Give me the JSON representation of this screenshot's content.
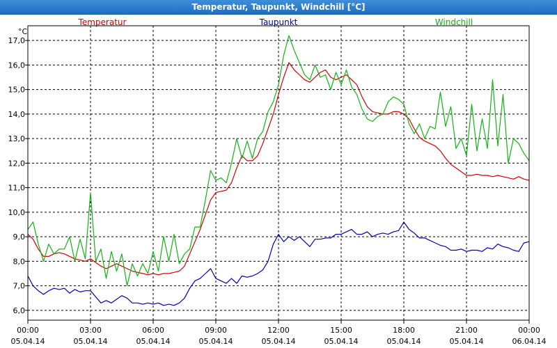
{
  "window": {
    "title": "Temperatur, Taupunkt, Windchill [°C]"
  },
  "chart_data": {
    "type": "line",
    "title": "Temperatur, Taupunkt, Windchill [°C]",
    "ylabel": "°C",
    "ylim": [
      5.6,
      17.6
    ],
    "xlim_hours": [
      0,
      24
    ],
    "grid": true,
    "legend_position": "top",
    "y_ticks": [
      "6,0",
      "7,0",
      "8,0",
      "9,0",
      "10,0",
      "11,0",
      "12,0",
      "13,0",
      "14,0",
      "15,0",
      "16,0",
      "17,0"
    ],
    "x_ticks": [
      {
        "time": "00:00",
        "date": "05.04.14"
      },
      {
        "time": "03:00",
        "date": "05.04.14"
      },
      {
        "time": "06:00",
        "date": "05.04.14"
      },
      {
        "time": "09:00",
        "date": "05.04.14"
      },
      {
        "time": "12:00",
        "date": "05.04.14"
      },
      {
        "time": "15:00",
        "date": "05.04.14"
      },
      {
        "time": "18:00",
        "date": "05.04.14"
      },
      {
        "time": "21:00",
        "date": "05.04.14"
      },
      {
        "time": "00:00",
        "date": "06.04.14"
      }
    ],
    "series": [
      {
        "name": "Temperatur",
        "color": "#d40000",
        "points": [
          [
            0,
            9.1
          ],
          [
            0.25,
            8.9
          ],
          [
            0.5,
            8.5
          ],
          [
            0.75,
            8.2
          ],
          [
            1.0,
            8.2
          ],
          [
            1.25,
            8.3
          ],
          [
            1.5,
            8.35
          ],
          [
            1.75,
            8.3
          ],
          [
            2.0,
            8.2
          ],
          [
            2.25,
            8.1
          ],
          [
            2.5,
            8.05
          ],
          [
            2.75,
            8.0
          ],
          [
            3.0,
            8.1
          ],
          [
            3.25,
            7.95
          ],
          [
            3.5,
            7.8
          ],
          [
            3.75,
            7.7
          ],
          [
            4.0,
            7.8
          ],
          [
            4.25,
            7.9
          ],
          [
            4.5,
            7.8
          ],
          [
            4.75,
            7.7
          ],
          [
            5.0,
            7.6
          ],
          [
            5.25,
            7.55
          ],
          [
            5.5,
            7.5
          ],
          [
            5.75,
            7.45
          ],
          [
            6.0,
            7.5
          ],
          [
            6.25,
            7.45
          ],
          [
            6.5,
            7.5
          ],
          [
            6.75,
            7.5
          ],
          [
            7.0,
            7.55
          ],
          [
            7.25,
            7.6
          ],
          [
            7.5,
            7.8
          ],
          [
            7.75,
            8.3
          ],
          [
            8.0,
            8.8
          ],
          [
            8.25,
            9.3
          ],
          [
            8.5,
            9.9
          ],
          [
            8.75,
            10.5
          ],
          [
            9.0,
            10.8
          ],
          [
            9.25,
            10.85
          ],
          [
            9.5,
            10.9
          ],
          [
            9.75,
            11.2
          ],
          [
            10.0,
            11.8
          ],
          [
            10.25,
            12.3
          ],
          [
            10.5,
            12.1
          ],
          [
            10.75,
            12.1
          ],
          [
            11.0,
            12.3
          ],
          [
            11.25,
            12.8
          ],
          [
            11.5,
            13.4
          ],
          [
            11.75,
            14.0
          ],
          [
            12.0,
            14.8
          ],
          [
            12.25,
            15.5
          ],
          [
            12.5,
            16.1
          ],
          [
            12.75,
            15.8
          ],
          [
            13.0,
            15.6
          ],
          [
            13.25,
            15.4
          ],
          [
            13.5,
            15.3
          ],
          [
            13.75,
            15.5
          ],
          [
            14.0,
            15.7
          ],
          [
            14.25,
            15.8
          ],
          [
            14.5,
            15.5
          ],
          [
            14.75,
            15.4
          ],
          [
            15.0,
            15.5
          ],
          [
            15.25,
            15.6
          ],
          [
            15.5,
            15.4
          ],
          [
            15.75,
            15.2
          ],
          [
            16.0,
            14.7
          ],
          [
            16.25,
            14.3
          ],
          [
            16.5,
            14.1
          ],
          [
            16.75,
            14.05
          ],
          [
            17.0,
            14.0
          ],
          [
            17.25,
            14.0
          ],
          [
            17.5,
            14.1
          ],
          [
            17.75,
            14.1
          ],
          [
            18.0,
            14.0
          ],
          [
            18.25,
            13.8
          ],
          [
            18.5,
            13.4
          ],
          [
            18.75,
            13.05
          ],
          [
            19.0,
            12.9
          ],
          [
            19.25,
            12.8
          ],
          [
            19.5,
            12.7
          ],
          [
            19.75,
            12.5
          ],
          [
            20.0,
            12.2
          ],
          [
            20.25,
            11.95
          ],
          [
            20.5,
            11.8
          ],
          [
            20.75,
            11.65
          ],
          [
            21.0,
            11.5
          ],
          [
            21.25,
            11.5
          ],
          [
            21.5,
            11.55
          ],
          [
            21.75,
            11.5
          ],
          [
            22.0,
            11.5
          ],
          [
            22.25,
            11.45
          ],
          [
            22.5,
            11.5
          ],
          [
            22.75,
            11.45
          ],
          [
            23.0,
            11.4
          ],
          [
            23.25,
            11.35
          ],
          [
            23.5,
            11.45
          ],
          [
            23.75,
            11.35
          ],
          [
            24.0,
            11.3
          ]
        ]
      },
      {
        "name": "Taupunkt",
        "color": "#0000b4",
        "points": [
          [
            0,
            7.4
          ],
          [
            0.25,
            7.0
          ],
          [
            0.5,
            6.8
          ],
          [
            0.75,
            6.65
          ],
          [
            1.0,
            6.8
          ],
          [
            1.25,
            6.9
          ],
          [
            1.5,
            6.85
          ],
          [
            1.75,
            6.9
          ],
          [
            2.0,
            6.7
          ],
          [
            2.25,
            6.85
          ],
          [
            2.5,
            6.75
          ],
          [
            2.75,
            6.8
          ],
          [
            3.0,
            6.8
          ],
          [
            3.25,
            6.55
          ],
          [
            3.5,
            6.3
          ],
          [
            3.75,
            6.4
          ],
          [
            4.0,
            6.3
          ],
          [
            4.25,
            6.45
          ],
          [
            4.5,
            6.6
          ],
          [
            4.75,
            6.5
          ],
          [
            5.0,
            6.3
          ],
          [
            5.25,
            6.3
          ],
          [
            5.5,
            6.25
          ],
          [
            5.75,
            6.3
          ],
          [
            6.0,
            6.25
          ],
          [
            6.25,
            6.3
          ],
          [
            6.5,
            6.2
          ],
          [
            6.75,
            6.25
          ],
          [
            7.0,
            6.2
          ],
          [
            7.25,
            6.3
          ],
          [
            7.5,
            6.5
          ],
          [
            7.75,
            6.9
          ],
          [
            8.0,
            7.2
          ],
          [
            8.25,
            7.3
          ],
          [
            8.5,
            7.5
          ],
          [
            8.75,
            7.7
          ],
          [
            9.0,
            7.3
          ],
          [
            9.25,
            7.2
          ],
          [
            9.5,
            7.1
          ],
          [
            9.75,
            7.3
          ],
          [
            10.0,
            7.1
          ],
          [
            10.25,
            7.4
          ],
          [
            10.5,
            7.35
          ],
          [
            10.75,
            7.4
          ],
          [
            11.0,
            7.5
          ],
          [
            11.25,
            7.65
          ],
          [
            11.5,
            8.0
          ],
          [
            11.75,
            8.7
          ],
          [
            12.0,
            9.1
          ],
          [
            12.25,
            8.8
          ],
          [
            12.5,
            9.0
          ],
          [
            12.75,
            8.85
          ],
          [
            13.0,
            9.0
          ],
          [
            13.25,
            8.8
          ],
          [
            13.5,
            8.6
          ],
          [
            13.75,
            8.9
          ],
          [
            14.0,
            8.9
          ],
          [
            14.25,
            8.95
          ],
          [
            14.5,
            8.95
          ],
          [
            14.75,
            9.1
          ],
          [
            15.0,
            9.1
          ],
          [
            15.25,
            9.2
          ],
          [
            15.5,
            9.3
          ],
          [
            15.75,
            9.1
          ],
          [
            16.0,
            9.1
          ],
          [
            16.25,
            9.2
          ],
          [
            16.5,
            9.0
          ],
          [
            16.75,
            9.1
          ],
          [
            17.0,
            9.15
          ],
          [
            17.25,
            9.1
          ],
          [
            17.5,
            9.2
          ],
          [
            17.75,
            9.25
          ],
          [
            18.0,
            9.6
          ],
          [
            18.25,
            9.3
          ],
          [
            18.5,
            9.15
          ],
          [
            18.75,
            8.95
          ],
          [
            19.0,
            8.95
          ],
          [
            19.25,
            8.85
          ],
          [
            19.5,
            8.75
          ],
          [
            19.75,
            8.65
          ],
          [
            20.0,
            8.6
          ],
          [
            20.25,
            8.45
          ],
          [
            20.5,
            8.45
          ],
          [
            20.75,
            8.5
          ],
          [
            21.0,
            8.4
          ],
          [
            21.25,
            8.45
          ],
          [
            21.5,
            8.45
          ],
          [
            21.75,
            8.4
          ],
          [
            22.0,
            8.55
          ],
          [
            22.25,
            8.5
          ],
          [
            22.5,
            8.7
          ],
          [
            22.75,
            8.6
          ],
          [
            23.0,
            8.55
          ],
          [
            23.25,
            8.45
          ],
          [
            23.5,
            8.4
          ],
          [
            23.75,
            8.75
          ],
          [
            24.0,
            8.8
          ]
        ]
      },
      {
        "name": "Windchill",
        "color": "#11b411",
        "points": [
          [
            0,
            9.3
          ],
          [
            0.25,
            9.6
          ],
          [
            0.5,
            8.7
          ],
          [
            0.75,
            8.0
          ],
          [
            1.0,
            8.7
          ],
          [
            1.25,
            8.3
          ],
          [
            1.5,
            8.5
          ],
          [
            1.75,
            8.5
          ],
          [
            2.0,
            9.0
          ],
          [
            2.25,
            8.0
          ],
          [
            2.5,
            8.9
          ],
          [
            2.75,
            8.1
          ],
          [
            3.0,
            10.8
          ],
          [
            3.25,
            8.0
          ],
          [
            3.5,
            8.5
          ],
          [
            3.75,
            7.3
          ],
          [
            4.0,
            8.4
          ],
          [
            4.25,
            7.6
          ],
          [
            4.5,
            8.3
          ],
          [
            4.75,
            7.0
          ],
          [
            5.0,
            7.9
          ],
          [
            5.25,
            7.4
          ],
          [
            5.5,
            7.9
          ],
          [
            5.75,
            7.5
          ],
          [
            6.0,
            8.4
          ],
          [
            6.25,
            7.6
          ],
          [
            6.5,
            9.0
          ],
          [
            6.75,
            8.0
          ],
          [
            7.0,
            9.1
          ],
          [
            7.25,
            7.9
          ],
          [
            7.5,
            8.3
          ],
          [
            7.75,
            8.5
          ],
          [
            8.0,
            9.4
          ],
          [
            8.25,
            9.4
          ],
          [
            8.5,
            10.5
          ],
          [
            8.75,
            11.7
          ],
          [
            9.0,
            11.3
          ],
          [
            9.25,
            11.4
          ],
          [
            9.5,
            11.2
          ],
          [
            9.75,
            12.0
          ],
          [
            10.0,
            13.0
          ],
          [
            10.25,
            12.2
          ],
          [
            10.5,
            12.9
          ],
          [
            10.75,
            12.2
          ],
          [
            11.0,
            13.0
          ],
          [
            11.25,
            13.3
          ],
          [
            11.5,
            14.1
          ],
          [
            11.75,
            14.5
          ],
          [
            12.0,
            15.2
          ],
          [
            12.25,
            16.4
          ],
          [
            12.5,
            17.2
          ],
          [
            12.75,
            16.6
          ],
          [
            13.0,
            16.1
          ],
          [
            13.25,
            15.6
          ],
          [
            13.5,
            15.4
          ],
          [
            13.75,
            16.0
          ],
          [
            14.0,
            15.5
          ],
          [
            14.25,
            15.6
          ],
          [
            14.5,
            15.0
          ],
          [
            14.75,
            15.7
          ],
          [
            15.0,
            15.2
          ],
          [
            15.25,
            15.8
          ],
          [
            15.5,
            15.1
          ],
          [
            15.75,
            14.8
          ],
          [
            16.0,
            14.2
          ],
          [
            16.25,
            13.8
          ],
          [
            16.5,
            13.7
          ],
          [
            16.75,
            13.9
          ],
          [
            17.0,
            14.0
          ],
          [
            17.25,
            14.5
          ],
          [
            17.5,
            14.7
          ],
          [
            17.75,
            14.6
          ],
          [
            18.0,
            14.4
          ],
          [
            18.25,
            13.6
          ],
          [
            18.5,
            13.2
          ],
          [
            18.75,
            13.6
          ],
          [
            19.0,
            13.0
          ],
          [
            19.25,
            13.5
          ],
          [
            19.5,
            13.4
          ],
          [
            19.75,
            14.9
          ],
          [
            20.0,
            13.5
          ],
          [
            20.25,
            14.3
          ],
          [
            20.5,
            12.6
          ],
          [
            20.75,
            13.0
          ],
          [
            21.0,
            12.3
          ],
          [
            21.25,
            14.4
          ],
          [
            21.5,
            12.5
          ],
          [
            21.75,
            13.8
          ],
          [
            22.0,
            12.6
          ],
          [
            22.25,
            15.4
          ],
          [
            22.5,
            12.7
          ],
          [
            22.75,
            14.8
          ],
          [
            23.0,
            12.0
          ],
          [
            23.25,
            13.0
          ],
          [
            23.5,
            12.8
          ],
          [
            23.75,
            12.4
          ],
          [
            24.0,
            12.1
          ]
        ]
      }
    ]
  }
}
